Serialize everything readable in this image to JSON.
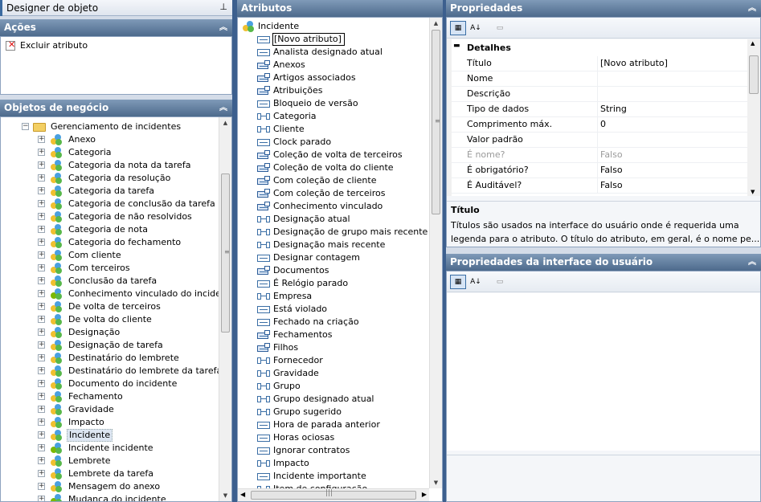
{
  "window": {
    "title": "Designer de objeto",
    "pin_icon": "pin-icon"
  },
  "actions": {
    "title": "Ações",
    "items": [
      {
        "label": "Excluir atributo",
        "icon": "delete-attribute-icon"
      }
    ]
  },
  "business_objects": {
    "title": "Objetos de negócio",
    "root": "Gerenciamento de incidentes",
    "items": [
      {
        "label": "Anexo"
      },
      {
        "label": "Categoria"
      },
      {
        "label": "Categoria da nota da tarefa"
      },
      {
        "label": "Categoria da resolução"
      },
      {
        "label": "Categoria da tarefa"
      },
      {
        "label": "Categoria de conclusão da tarefa"
      },
      {
        "label": "Categoria de não resolvidos"
      },
      {
        "label": "Categoria de nota"
      },
      {
        "label": "Categoria do fechamento"
      },
      {
        "label": "Com cliente"
      },
      {
        "label": "Com terceiros"
      },
      {
        "label": "Conclusão da tarefa"
      },
      {
        "label": "Conhecimento vinculado do incidente"
      },
      {
        "label": "De volta de terceiros"
      },
      {
        "label": "De volta do cliente"
      },
      {
        "label": "Designação"
      },
      {
        "label": "Designação de tarefa"
      },
      {
        "label": "Destinatário do lembrete"
      },
      {
        "label": "Destinatário do lembrete da tarefa"
      },
      {
        "label": "Documento do incidente"
      },
      {
        "label": "Fechamento"
      },
      {
        "label": "Gravidade"
      },
      {
        "label": "Impacto"
      },
      {
        "label": "Incidente"
      },
      {
        "label": "Incidente incidente"
      },
      {
        "label": "Lembrete"
      },
      {
        "label": "Lembrete da tarefa"
      },
      {
        "label": "Mensagem do anexo"
      },
      {
        "label": "Mudança do incidente"
      }
    ],
    "selected": "Incidente"
  },
  "attributes": {
    "title": "Atributos",
    "root": "Incidente",
    "new_attribute": "[Novo atributo]",
    "items": [
      {
        "label": "Analista designado atual",
        "kind": "single"
      },
      {
        "label": "Anexos",
        "kind": "collection"
      },
      {
        "label": "Artigos associados",
        "kind": "collection"
      },
      {
        "label": "Atribuições",
        "kind": "collection"
      },
      {
        "label": "Bloqueio de versão",
        "kind": "single"
      },
      {
        "label": "Categoria",
        "kind": "link"
      },
      {
        "label": "Cliente",
        "kind": "link"
      },
      {
        "label": "Clock parado",
        "kind": "single"
      },
      {
        "label": "Coleção de volta de terceiros",
        "kind": "collection"
      },
      {
        "label": "Coleção de volta do cliente",
        "kind": "collection"
      },
      {
        "label": "Com coleção de cliente",
        "kind": "collection"
      },
      {
        "label": "Com coleção de terceiros",
        "kind": "collection"
      },
      {
        "label": "Conhecimento vinculado",
        "kind": "collection"
      },
      {
        "label": "Designação atual",
        "kind": "link"
      },
      {
        "label": "Designação de grupo mais recente",
        "kind": "link"
      },
      {
        "label": "Designação mais recente",
        "kind": "link"
      },
      {
        "label": "Designar contagem",
        "kind": "single"
      },
      {
        "label": "Documentos",
        "kind": "collection"
      },
      {
        "label": "É Relógio parado",
        "kind": "single"
      },
      {
        "label": "Empresa",
        "kind": "link"
      },
      {
        "label": "Está violado",
        "kind": "single"
      },
      {
        "label": "Fechado na criação",
        "kind": "single"
      },
      {
        "label": "Fechamentos",
        "kind": "collection"
      },
      {
        "label": "Filhos",
        "kind": "collection"
      },
      {
        "label": "Fornecedor",
        "kind": "link"
      },
      {
        "label": "Gravidade",
        "kind": "link"
      },
      {
        "label": "Grupo",
        "kind": "link"
      },
      {
        "label": "Grupo designado atual",
        "kind": "link"
      },
      {
        "label": "Grupo sugerido",
        "kind": "link"
      },
      {
        "label": "Hora de parada anterior",
        "kind": "single"
      },
      {
        "label": "Horas ociosas",
        "kind": "single"
      },
      {
        "label": "Ignorar contratos",
        "kind": "single"
      },
      {
        "label": "Impacto",
        "kind": "link"
      },
      {
        "label": "Incidente importante",
        "kind": "single"
      },
      {
        "label": "Item de configuração",
        "kind": "link"
      }
    ]
  },
  "properties": {
    "title": "Propriedades",
    "section": "Detalhes",
    "rows": [
      {
        "key": "Título",
        "value": "[Novo atributo]",
        "disabled": false
      },
      {
        "key": "Nome",
        "value": "",
        "disabled": false
      },
      {
        "key": "Descrição",
        "value": "",
        "disabled": false
      },
      {
        "key": "Tipo de dados",
        "value": "String",
        "disabled": false
      },
      {
        "key": "Comprimento máx.",
        "value": "0",
        "disabled": false
      },
      {
        "key": "Valor padrão",
        "value": "",
        "disabled": false
      },
      {
        "key": "É nome?",
        "value": "Falso",
        "disabled": true
      },
      {
        "key": "É obrigatório?",
        "value": "Falso",
        "disabled": false
      },
      {
        "key": "É Auditável?",
        "value": "Falso",
        "disabled": false
      }
    ],
    "help_title": "Título",
    "help_text_1": "Títulos são usados na interface do usuário onde é requerida uma",
    "help_text_2": "legenda para o atributo. O título do atributo, em geral, é o nome pe..."
  },
  "ui_properties": {
    "title": "Propriedades da interface do usuário"
  },
  "colors": {
    "header_top": "#7f9ab8",
    "header_bottom": "#4d6a8c",
    "frame": "#d4dce8",
    "selection": "#dde6f2"
  }
}
